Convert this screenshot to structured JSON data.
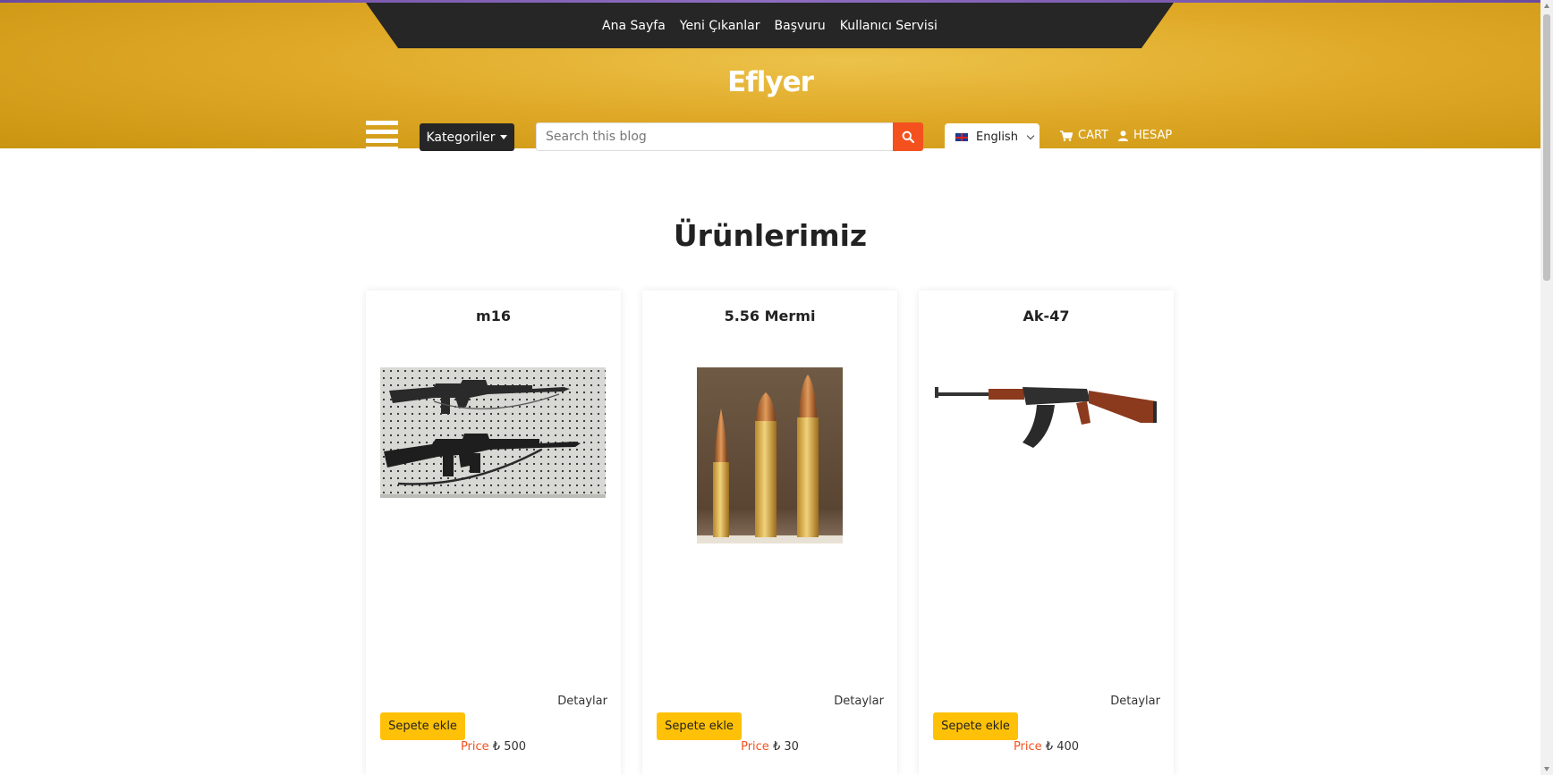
{
  "nav": {
    "links": [
      "Ana Sayfa",
      "Yeni Çıkanlar",
      "Başvuru",
      "Kullanıcı Servisi"
    ]
  },
  "brand": {
    "logo": "Eflyer"
  },
  "toolbar": {
    "categories_label": "Kategoriler",
    "search_placeholder": "Search this blog",
    "language": "English",
    "cart_label": "CART",
    "account_label": "HESAP"
  },
  "section": {
    "title": "Ürünlerimiz"
  },
  "products": [
    {
      "name": "m16",
      "details_label": "Detaylar",
      "add_label": "Sepete ekle",
      "price_label": "Price",
      "currency": "₺",
      "price": "500"
    },
    {
      "name": "5.56 Mermi",
      "details_label": "Detaylar",
      "add_label": "Sepete ekle",
      "price_label": "Price",
      "currency": "₺",
      "price": "30"
    },
    {
      "name": "Ak-47",
      "details_label": "Detaylar",
      "add_label": "Sepete ekle",
      "price_label": "Price",
      "currency": "₺",
      "price": "400"
    }
  ],
  "colors": {
    "header_gold": "#e0aa28",
    "nav_dark": "#262626",
    "search_button": "#f4511e",
    "add_button": "#ffc107",
    "price_label": "#f4511e"
  },
  "icons": [
    "hamburger-icon",
    "search-icon",
    "flag-uk-icon",
    "chevron-down-icon",
    "cart-icon",
    "user-icon"
  ]
}
